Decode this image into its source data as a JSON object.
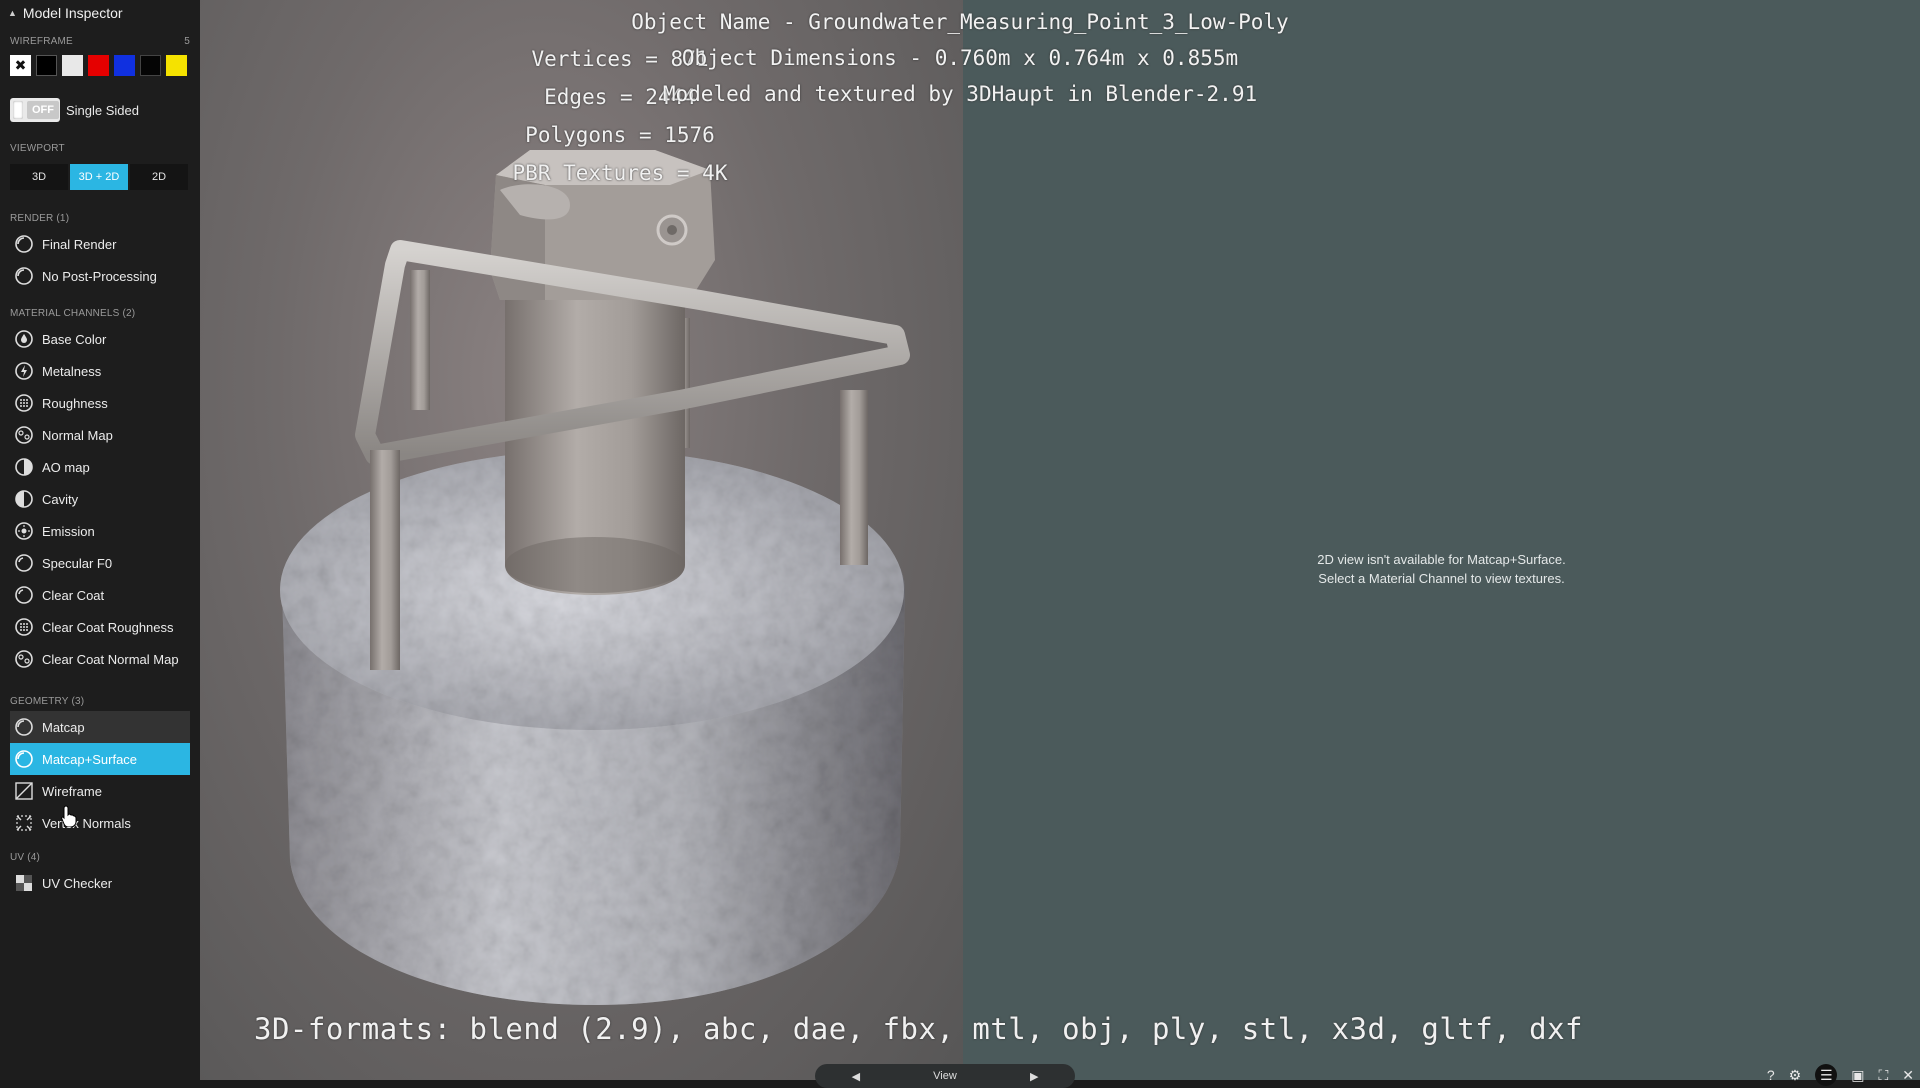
{
  "sidebar": {
    "title": "Model Inspector",
    "wireframe": {
      "label": "WIREFRAME",
      "count": "5",
      "swatches": [
        "#ffffff",
        "#000000",
        "#e8e8e8",
        "#e50000",
        "#1030e0",
        "#050505",
        "#f5e200"
      ]
    },
    "single_sided": {
      "toggle_state": "OFF",
      "label": "Single Sided"
    },
    "viewport": {
      "label": "VIEWPORT",
      "options": [
        "3D",
        "3D + 2D",
        "2D"
      ],
      "selected": "3D + 2D"
    },
    "render": {
      "label": "RENDER (1)",
      "items": [
        "Final Render",
        "No Post-Processing"
      ]
    },
    "material_channels": {
      "label": "MATERIAL CHANNELS (2)",
      "items": [
        "Base Color",
        "Metalness",
        "Roughness",
        "Normal Map",
        "AO map",
        "Cavity",
        "Emission",
        "Specular F0",
        "Clear Coat",
        "Clear Coat Roughness",
        "Clear Coat Normal Map"
      ]
    },
    "geometry": {
      "label": "GEOMETRY (3)",
      "items": [
        "Matcap",
        "Matcap+Surface",
        "Wireframe",
        "Vertex Normals"
      ],
      "hovered": "Matcap",
      "selected": "Matcap+Surface"
    },
    "uv": {
      "label": "UV (4)",
      "items": [
        "UV Checker"
      ]
    }
  },
  "overlay": {
    "stats": [
      "Vertices = 871",
      "Edges = 2444",
      "Polygons = 1576",
      "PBR Textures = 4K"
    ],
    "info": [
      "Object Name - Groundwater_Measuring_Point_3_Low-Poly",
      "Object Dimensions - 0.760m x 0.764m x 0.855m",
      "Modeled and textured by 3DHaupt in Blender-2.91"
    ],
    "formats": "3D-formats: blend (2.9), abc, dae, fbx, mtl, obj, ply, stl, x3d, gltf, dxf"
  },
  "view2d": {
    "message_line1": "2D view isn't available for Matcap+Surface.",
    "message_line2": "Select a Material Channel to view textures."
  },
  "bottom_nav": {
    "label": "View"
  },
  "colors": {
    "accent": "#2bb6e3",
    "panel": "#1d1d1d",
    "view2d_bg": "#4b5a5b"
  }
}
